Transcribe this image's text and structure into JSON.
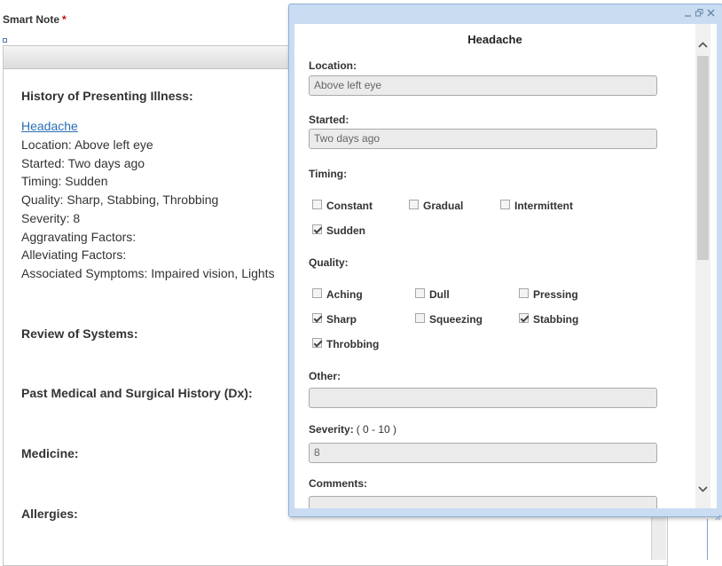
{
  "smart_note": {
    "label": "Smart Note",
    "required_mark": "*"
  },
  "editor": {
    "hpi_heading": "History of Presenting Illness:",
    "hpi_link": "Headache",
    "hpi_lines": [
      "Location: Above left eye",
      "Started: Two days ago",
      "Timing: Sudden",
      "Quality: Sharp, Stabbing, Throbbing",
      "Severity: 8",
      "Aggravating Factors:",
      "Alleviating Factors:",
      "Associated Symptoms: Impaired vision, Lights"
    ],
    "sections": [
      "Review of Systems:",
      "Past Medical and Surgical History (Dx):",
      "Medicine:",
      "Allergies:"
    ]
  },
  "popup": {
    "title": "Headache",
    "window_controls": {
      "minimize": "minimize-icon",
      "restore": "restore-icon",
      "close": "close-icon"
    },
    "location": {
      "label": "Location:",
      "value": "Above left eye"
    },
    "started": {
      "label": "Started:",
      "value": "Two days ago"
    },
    "timing": {
      "label": "Timing:",
      "options": [
        {
          "label": "Constant",
          "checked": false
        },
        {
          "label": "Gradual",
          "checked": false
        },
        {
          "label": "Intermittent",
          "checked": false
        },
        {
          "label": "Sudden",
          "checked": true
        }
      ]
    },
    "quality": {
      "label": "Quality:",
      "options": [
        {
          "label": "Aching",
          "checked": false
        },
        {
          "label": "Dull",
          "checked": false
        },
        {
          "label": "Pressing",
          "checked": false
        },
        {
          "label": "Sharp",
          "checked": true
        },
        {
          "label": "Squeezing",
          "checked": false
        },
        {
          "label": "Stabbing",
          "checked": true
        },
        {
          "label": "Throbbing",
          "checked": true
        }
      ]
    },
    "other": {
      "label": "Other:",
      "value": ""
    },
    "severity": {
      "label": "Severity:",
      "range": "( 0 - 10 )",
      "value": "8"
    },
    "comments": {
      "label": "Comments:",
      "value": ""
    },
    "scrollbar": {
      "up_icon": "chevron-up-icon",
      "down_icon": "chevron-down-icon"
    }
  }
}
